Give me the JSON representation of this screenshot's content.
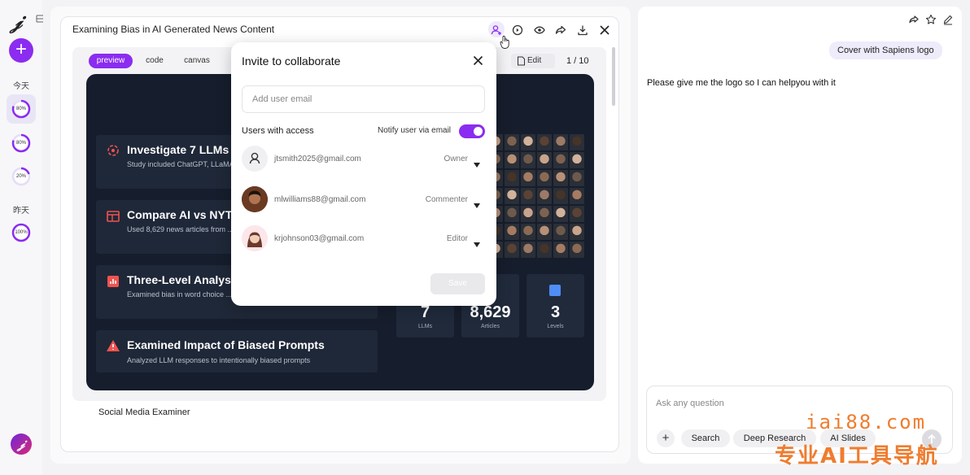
{
  "sidebar": {
    "today_label": "今天",
    "yesterday_label": "昨天",
    "history": [
      {
        "progress_label": "80%",
        "progress": 0.8
      },
      {
        "progress_label": "80%",
        "progress": 0.8
      },
      {
        "progress_label": "20%",
        "progress": 0.2
      },
      {
        "progress_label": "100%",
        "progress": 1.0
      }
    ],
    "new_label": "+"
  },
  "document": {
    "title": "Examining Bias in AI Generated News Content",
    "tabs": [
      "preview",
      "code",
      "canvas"
    ],
    "edit_label": "Edit",
    "page_counter": "1 / 10",
    "caption": "Social Media Examiner"
  },
  "slide": {
    "cards": [
      {
        "title": "Investigate 7 LLMs",
        "desc": "Study included ChatGPT, LLaMA, davinci, and Cohere."
      },
      {
        "title": "Compare AI vs NYT",
        "desc": "Used 8,629 news articles from ... unbiased benchmarks."
      },
      {
        "title": "Three-Level Analysis",
        "desc": "Examined bias in word choice ... conveyed semantics at word, s..."
      },
      {
        "title": "Examined Impact of Biased Prompts",
        "desc": "Analyzed LLM responses to intentionally biased prompts"
      }
    ],
    "stats": [
      {
        "value": "7",
        "label": "LLMs"
      },
      {
        "value": "8,629",
        "label": "Articles"
      },
      {
        "value": "3",
        "label": "Levels"
      }
    ]
  },
  "modal": {
    "title": "Invite to collaborate",
    "email_placeholder": "Add user email",
    "users_label": "Users with access",
    "notify_label": "Notify user via email",
    "notify_on": true,
    "users": [
      {
        "email": "jtsmith2025@gmail.com",
        "role": "Owner"
      },
      {
        "email": "mlwilliams88@gmail.com",
        "role": "Commenter"
      },
      {
        "email": "krjohnson03@gmail.com",
        "role": "Editor"
      }
    ],
    "save_label": "Save"
  },
  "chat": {
    "user_message": "Cover with Sapiens logo",
    "ai_message": "Please give me the logo so I can helpyou with it",
    "input_placeholder": "Ask any question",
    "chips": [
      "Search",
      "Deep Research",
      "AI Slides"
    ]
  },
  "watermark": {
    "site": "iai88.com",
    "text": "专业AI工具导航"
  },
  "colors": {
    "accent": "#8b2cf0",
    "slide_bg": "#161d2c",
    "watermark": "#f07c2e"
  }
}
